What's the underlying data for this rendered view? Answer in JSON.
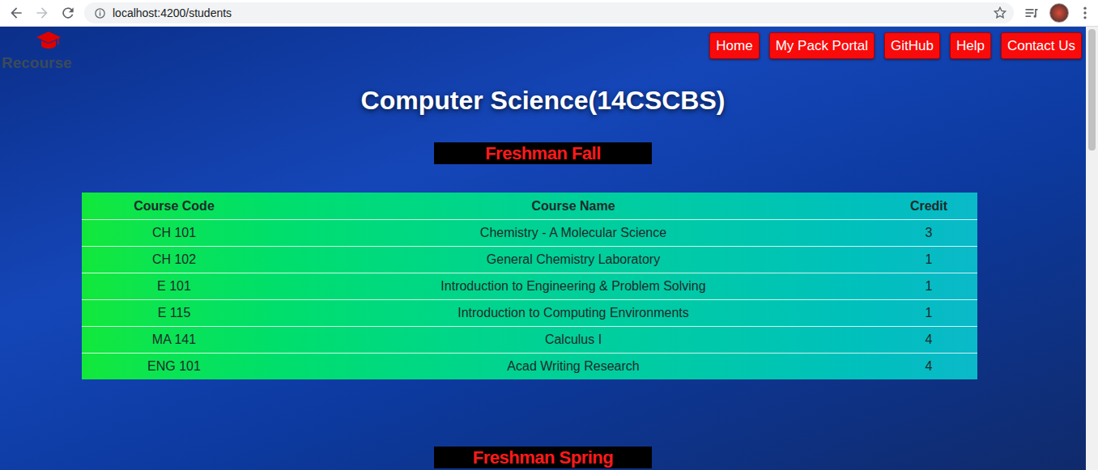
{
  "browser": {
    "url": "localhost:4200/students"
  },
  "logo": {
    "text": "Recourse"
  },
  "nav": [
    "Home",
    "My Pack Portal",
    "GitHub",
    "Help",
    "Contact Us"
  ],
  "title": "Computer Science(14CSCBS)",
  "semesters": [
    {
      "label": "Freshman Fall",
      "table": {
        "columns": [
          "Course Code",
          "Course Name",
          "Credit"
        ],
        "rows": [
          [
            "CH 101",
            "Chemistry - A Molecular Science",
            "3"
          ],
          [
            "CH 102",
            "General Chemistry Laboratory",
            "1"
          ],
          [
            "E 101",
            "Introduction to Engineering & Problem Solving",
            "1"
          ],
          [
            "E 115",
            "Introduction to Computing Environments",
            "1"
          ],
          [
            "MA 141",
            "Calculus I",
            "4"
          ],
          [
            "ENG 101",
            "Acad Writing Research",
            "4"
          ]
        ]
      }
    },
    {
      "label": "Freshman Spring"
    }
  ]
}
